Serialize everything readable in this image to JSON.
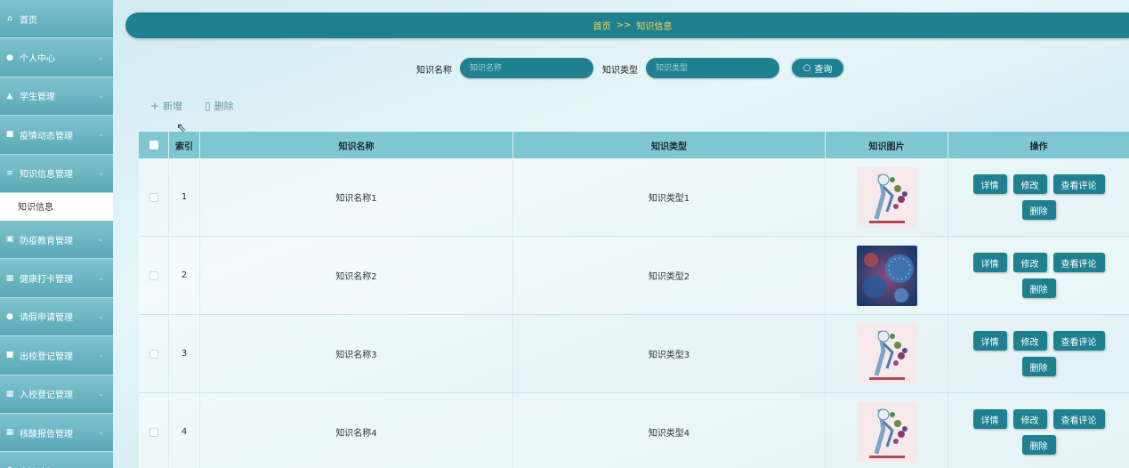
{
  "sidebar": {
    "items": [
      {
        "label": "首页",
        "icon": "home-icon",
        "glyph": "⌂",
        "chevron": false
      },
      {
        "label": "个人中心",
        "icon": "user-icon",
        "glyph": "●",
        "chevron": true
      },
      {
        "label": "学生管理",
        "icon": "thumbs-up-icon",
        "glyph": "▲",
        "chevron": true
      },
      {
        "label": "疫情动态管理",
        "icon": "comment-icon",
        "glyph": "■",
        "chevron": true
      },
      {
        "label": "知识信息管理",
        "icon": "list-icon",
        "glyph": "≡",
        "chevron": true
      },
      {
        "label": "防疫教育管理",
        "icon": "card-icon",
        "glyph": "▣",
        "chevron": true
      },
      {
        "label": "健康打卡管理",
        "icon": "grid-icon",
        "glyph": "▦",
        "chevron": true
      },
      {
        "label": "请假申请管理",
        "icon": "user-icon",
        "glyph": "●",
        "chevron": true
      },
      {
        "label": "出校登记管理",
        "icon": "comment-icon",
        "glyph": "■",
        "chevron": true
      },
      {
        "label": "入校登记管理",
        "icon": "grid-icon",
        "glyph": "▦",
        "chevron": true
      },
      {
        "label": "核酸报告管理",
        "icon": "grid-icon",
        "glyph": "▦",
        "chevron": true
      },
      {
        "label": "交流论坛",
        "icon": "chart-icon",
        "glyph": "▮",
        "chevron": true
      }
    ],
    "active_sub": "知识信息"
  },
  "breadcrumb": {
    "home": "首页",
    "sep": ">>",
    "current": "知识信息"
  },
  "search": {
    "name_label": "知识名称",
    "name_placeholder": "知识名称",
    "type_label": "知识类型",
    "type_placeholder": "知识类型",
    "button_label": "查询"
  },
  "actions": {
    "add": "新增",
    "delete": "删除"
  },
  "table": {
    "headers": [
      "索引",
      "知识名称",
      "知识类型",
      "知识图片",
      "操作"
    ],
    "rows": [
      {
        "index": "1",
        "name": "知识名称1",
        "type": "知识类型1",
        "image": "poster"
      },
      {
        "index": "2",
        "name": "知识名称2",
        "type": "知识类型2",
        "image": "virus"
      },
      {
        "index": "3",
        "name": "知识名称3",
        "type": "知识类型3",
        "image": "poster"
      },
      {
        "index": "4",
        "name": "知识名称4",
        "type": "知识类型4",
        "image": "poster"
      }
    ],
    "ops": {
      "detail": "详情",
      "edit": "修改",
      "comments": "查看评论",
      "delete": "删除"
    }
  }
}
